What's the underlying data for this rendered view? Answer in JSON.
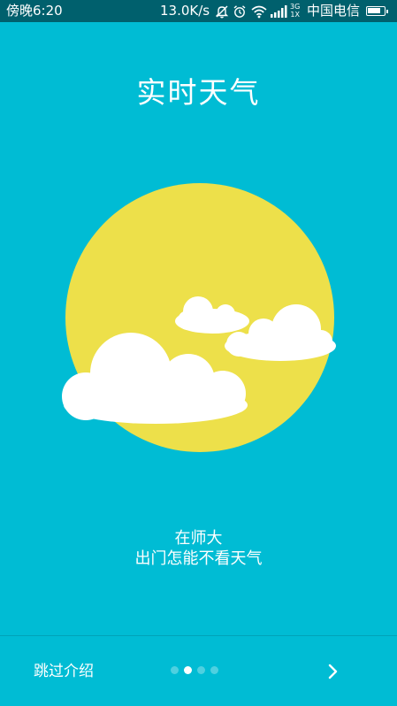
{
  "status_bar": {
    "time": "傍晚6:20",
    "network_speed": "13.0K/s",
    "net_type_top": "3G",
    "net_type_bottom": "1X",
    "carrier": "中国电信",
    "battery_level": 0.9,
    "icons": [
      "mute-icon",
      "alarm-icon",
      "wifi-icon",
      "signal-icon",
      "battery-icon"
    ]
  },
  "title": "实时天气",
  "slogan": {
    "line1": "在师大",
    "line2": "出门怎能不看天气"
  },
  "bottom": {
    "skip_label": "跳过介绍",
    "page_count": 4,
    "current_page": 2,
    "next_icon": "chevron-right-icon"
  },
  "colors": {
    "background": "#00bcd4",
    "status_bar": "#00606d",
    "sun": "#ede04a",
    "cloud": "#ffffff",
    "dot_inactive": "#4fd0e0",
    "dot_active": "#ffffff"
  }
}
